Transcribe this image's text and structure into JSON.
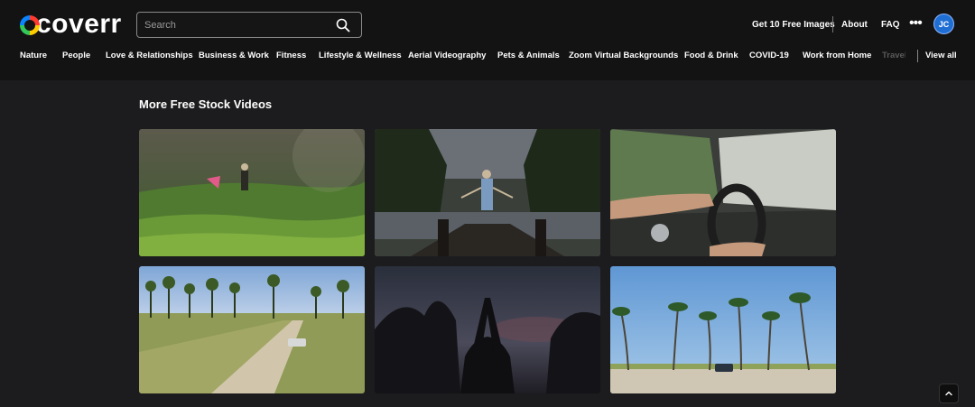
{
  "brand": {
    "logo_text": "coverr"
  },
  "search": {
    "placeholder": "Search"
  },
  "header": {
    "links": [
      "Get 10 Free Images",
      "About",
      "FAQ"
    ],
    "avatar_initials": "JC"
  },
  "categories": [
    "Nature",
    "People",
    "Love & Relationships",
    "Business & Work",
    "Fitness",
    "Lifestyle & Wellness",
    "Aerial Videography",
    "Pets & Animals",
    "Zoom Virtual Backgrounds",
    "Food & Drink",
    "COVID-19",
    "Work from Home",
    "Travel"
  ],
  "view_all": "View all",
  "section": {
    "title": "More Free Stock Videos"
  },
  "videos": [
    {
      "scene": "person flying kite on green hillside",
      "icon": "video-thumbnail"
    },
    {
      "scene": "person standing on dock facing lake",
      "icon": "video-thumbnail"
    },
    {
      "scene": "hands on steering wheel driving",
      "icon": "video-thumbnail"
    },
    {
      "scene": "car on dirt road with palm trees",
      "icon": "video-thumbnail"
    },
    {
      "scene": "silhouette hands raised at dusk",
      "icon": "video-thumbnail"
    },
    {
      "scene": "palm trees on beach with jeep",
      "icon": "video-thumbnail"
    }
  ],
  "colors": {
    "background": "#1c1c1e",
    "header": "#131313",
    "avatar": "#1f6ed4"
  }
}
